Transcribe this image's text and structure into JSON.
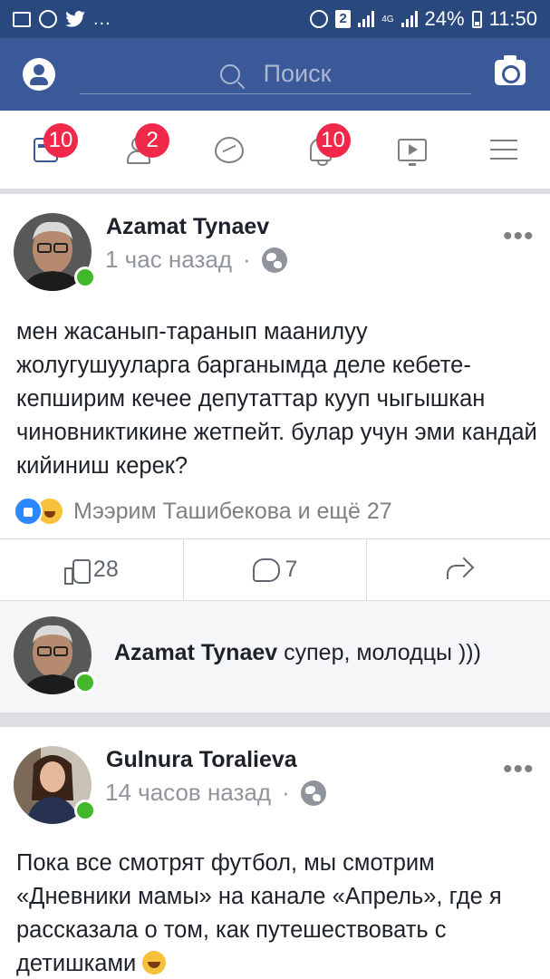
{
  "status_bar": {
    "time": "11:50",
    "battery": "24%",
    "sim": "2",
    "network": "4G",
    "notification_icons": [
      "gallery-icon",
      "whatsapp-icon",
      "twitter-icon",
      "more-dots-icon"
    ],
    "more": "..."
  },
  "top_bar": {
    "search_placeholder": "Поиск"
  },
  "nav_tabs": [
    {
      "name": "news-feed",
      "badge": "10"
    },
    {
      "name": "friend-requests",
      "badge": "2"
    },
    {
      "name": "messenger",
      "badge": ""
    },
    {
      "name": "notifications",
      "badge": "10"
    },
    {
      "name": "watch",
      "badge": ""
    },
    {
      "name": "menu",
      "badge": ""
    }
  ],
  "posts": [
    {
      "author": "Azamat Tynaev",
      "time": "1 час назад",
      "separator": "·",
      "more": "•••",
      "text": "мен жасанып-таранып маанилуу жолугушууларга барганымда деле кебете-кепширим кечее депутаттар кууп чыгышкан чиновниктикине жетпейт. булар учун эми кандай кийиниш керек?",
      "reactions_text": "Мээрим Ташибекова и ещё 27",
      "likes": "28",
      "comments": "7",
      "top_comment": {
        "author": "Azamat Tynaev",
        "text": "супер, молодцы )))"
      }
    },
    {
      "author": "Gulnura Toralieva",
      "time": "14 часов назад",
      "separator": "·",
      "more": "•••",
      "text": "Пока все смотрят футбол,  мы смотрим «Дневники мамы» на канале «Апрель», где я рассказала о том, как путешествовать с детишками"
    }
  ],
  "colors": {
    "status_bar": "#29487d",
    "header": "#3b5998",
    "badge": "#f02849",
    "online": "#42b72a",
    "muted_text": "#90949c"
  }
}
